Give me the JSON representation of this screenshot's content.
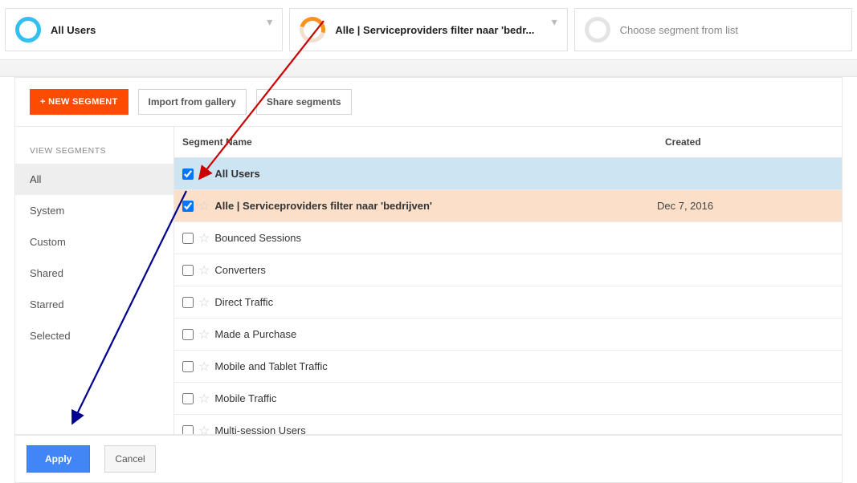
{
  "segments_top": [
    {
      "label": "All Users",
      "color": "blue",
      "placeholder": false
    },
    {
      "label": "Alle | Serviceproviders filter naar 'bedr...",
      "color": "orange",
      "placeholder": false
    },
    {
      "label": "Choose segment from list",
      "color": "grey",
      "placeholder": true
    }
  ],
  "toolbar": {
    "new_segment": "+ NEW SEGMENT",
    "import": "Import from gallery",
    "share": "Share segments"
  },
  "sidebar": {
    "header": "VIEW SEGMENTS",
    "items": [
      {
        "label": "All",
        "active": true
      },
      {
        "label": "System",
        "active": false
      },
      {
        "label": "Custom",
        "active": false
      },
      {
        "label": "Shared",
        "active": false
      },
      {
        "label": "Starred",
        "active": false
      },
      {
        "label": "Selected",
        "active": false
      }
    ]
  },
  "table": {
    "columns": {
      "name": "Segment Name",
      "created": "Created"
    },
    "rows": [
      {
        "name": "All Users",
        "created": "",
        "checked": true,
        "bold": true,
        "bg": "blue"
      },
      {
        "name": "Alle | Serviceproviders filter naar 'bedrijven'",
        "created": "Dec 7, 2016",
        "checked": true,
        "bold": true,
        "bg": "peach"
      },
      {
        "name": "Bounced Sessions",
        "created": "",
        "checked": false,
        "bold": false,
        "bg": ""
      },
      {
        "name": "Converters",
        "created": "",
        "checked": false,
        "bold": false,
        "bg": ""
      },
      {
        "name": "Direct Traffic",
        "created": "",
        "checked": false,
        "bold": false,
        "bg": ""
      },
      {
        "name": "Made a Purchase",
        "created": "",
        "checked": false,
        "bold": false,
        "bg": ""
      },
      {
        "name": "Mobile and Tablet Traffic",
        "created": "",
        "checked": false,
        "bold": false,
        "bg": ""
      },
      {
        "name": "Mobile Traffic",
        "created": "",
        "checked": false,
        "bold": false,
        "bg": ""
      },
      {
        "name": "Multi-session Users",
        "created": "",
        "checked": false,
        "bold": false,
        "bg": ""
      }
    ]
  },
  "footer": {
    "apply": "Apply",
    "cancel": "Cancel"
  }
}
